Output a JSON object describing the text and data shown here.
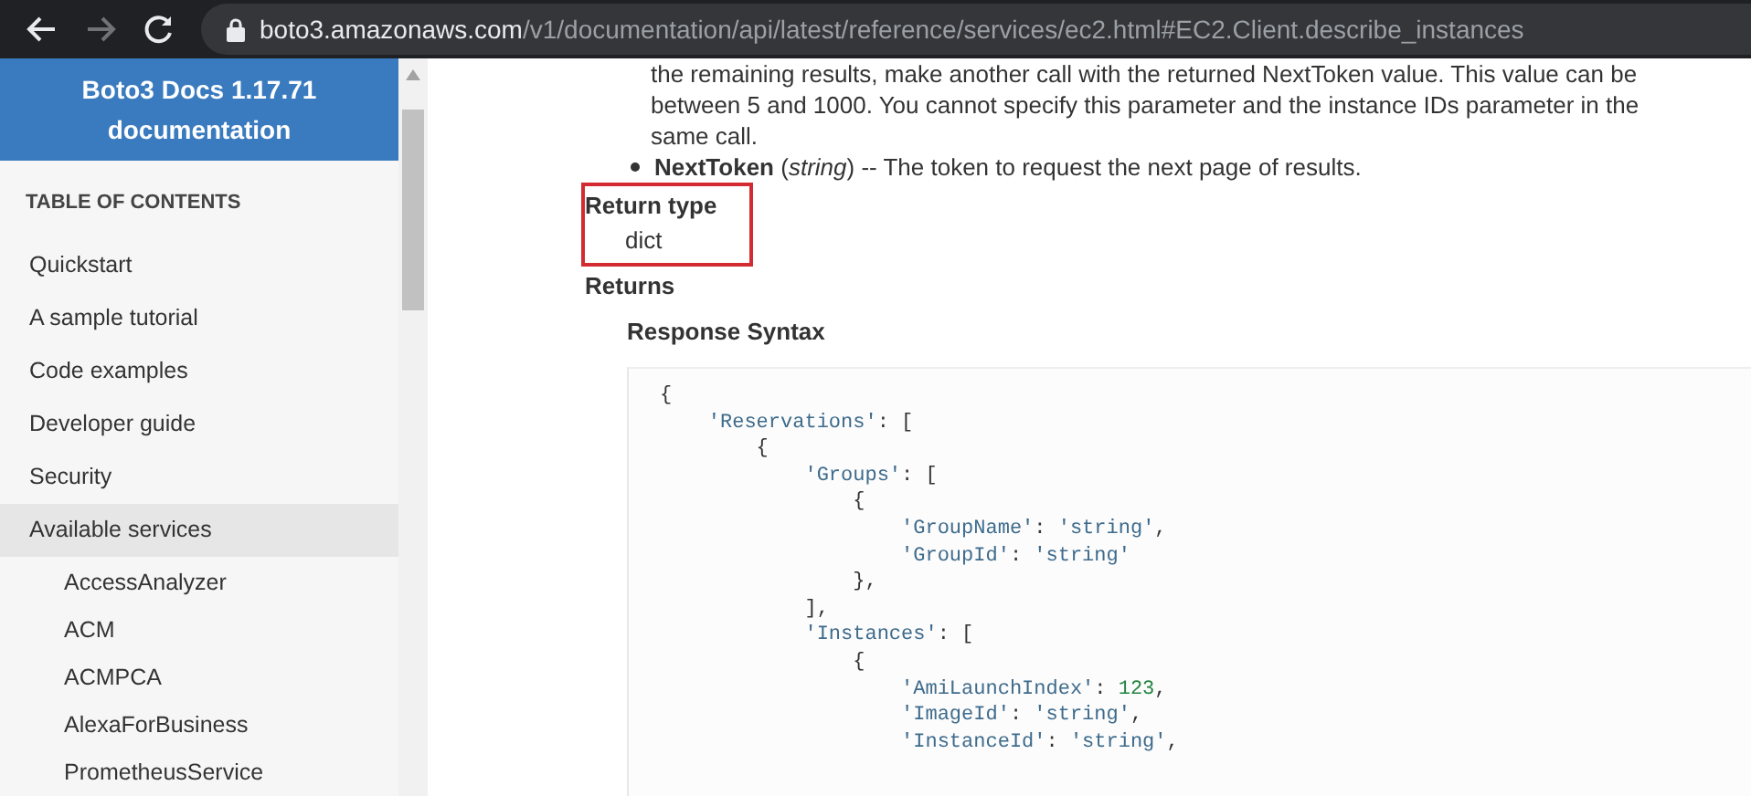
{
  "browser": {
    "url_host": "boto3.amazonaws.com",
    "url_path": "/v1/documentation/api/latest/reference/services/ec2.html#EC2.Client.describe_instances"
  },
  "sidebar": {
    "title_lines": [
      "Boto3 Docs 1.17.71",
      "documentation"
    ],
    "toc_heading": "TABLE OF CONTENTS",
    "items": [
      {
        "label": "Quickstart",
        "selected": false
      },
      {
        "label": "A sample tutorial",
        "selected": false
      },
      {
        "label": "Code examples",
        "selected": false
      },
      {
        "label": "Developer guide",
        "selected": false
      },
      {
        "label": "Security",
        "selected": false
      },
      {
        "label": "Available services",
        "selected": true,
        "children": [
          {
            "label": "AccessAnalyzer",
            "selected": false
          },
          {
            "label": "ACM",
            "selected": false
          },
          {
            "label": "ACMPCA",
            "selected": false
          },
          {
            "label": "AlexaForBusiness",
            "selected": false
          },
          {
            "label": "PrometheusService",
            "selected": false
          }
        ]
      }
    ]
  },
  "content": {
    "param_text_lines": [
      "the remaining results, make another call with the returned NextToken value. This value can be",
      "between 5 and 1000. You cannot specify this parameter and the instance IDs parameter in the",
      "same call."
    ],
    "bullet": {
      "text": "**NextToken** (*string*) -- The token to request the next page of results."
    },
    "return_type": {
      "label": "Return type",
      "value": "dict",
      "highlighted": true
    },
    "returns_label": "Returns",
    "response_syntax_label": "Response Syntax",
    "code_lines": [
      "{",
      "    'Reservations': [",
      "        {",
      "            'Groups': [",
      "                {",
      "                    'GroupName': 'string',",
      "                    'GroupId': 'string'",
      "                },",
      "            ],",
      "            'Instances': [",
      "                {",
      "                    'AmiLaunchIndex': 123,",
      "                    'ImageId': 'string',",
      "                    'InstanceId': 'string',"
    ]
  }
}
